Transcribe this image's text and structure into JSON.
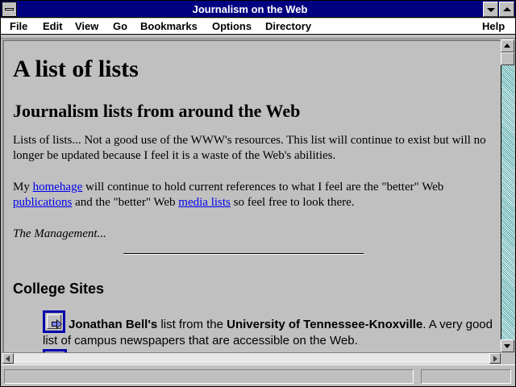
{
  "window": {
    "title": "Journalism on the Web"
  },
  "menu": {
    "items": [
      {
        "label": "File"
      },
      {
        "label": "Edit"
      },
      {
        "label": "View"
      },
      {
        "label": "Go"
      },
      {
        "label": "Bookmarks"
      },
      {
        "label": "Options"
      },
      {
        "label": "Directory"
      },
      {
        "label": "Help"
      }
    ]
  },
  "page": {
    "heading": "A list of lists",
    "subheading": "Journalism lists from around the Web",
    "intro": "Lists of lists... Not a good use of the WWW's resources. This list will continue to exist but will no longer be updated because I feel it is a waste of the Web's abilities.",
    "para2": {
      "t1": "My ",
      "link1": "homehage",
      "t2": " will continue to hold current references to what I feel are the \"better\" Web ",
      "link2": "publications",
      "t3": " and the \"better\" Web ",
      "link3": "media lists",
      "t4": " so feel free to look there."
    },
    "signature": "The Management...",
    "section_title": "College Sites",
    "entry": {
      "name": "Jonathan Bell's",
      "t1": " list from the ",
      "org": "University of Tennessee-Knoxville",
      "t2": ". A very good list of campus newspapers that are accessible on the Web."
    }
  },
  "icons": {
    "entry_icon": "arrow-right-icon"
  },
  "colors": {
    "titlebar": "#000080",
    "link": "#0000ee",
    "background": "#c0c0c0"
  }
}
